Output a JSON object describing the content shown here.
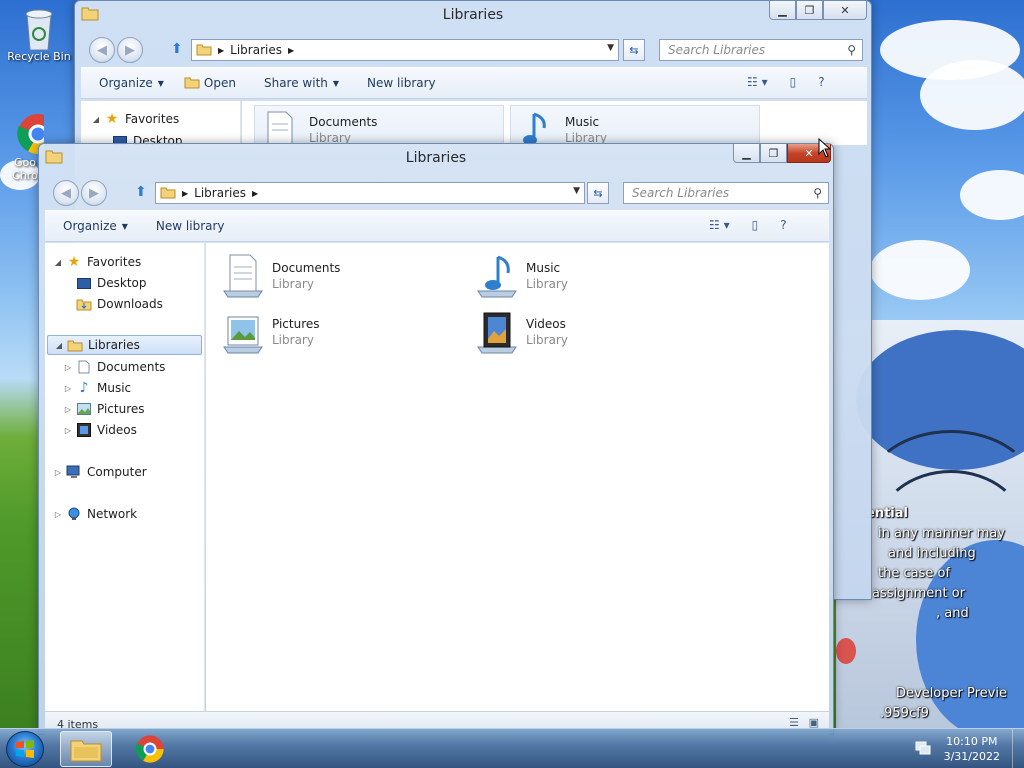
{
  "desktop": {
    "icons": [
      {
        "label": "Recycle Bin",
        "icon": "recycle-bin-icon"
      },
      {
        "label": "Goo Chro",
        "icon": "chrome-icon"
      }
    ],
    "watermark": {
      "line1": "ential",
      "line2": "in any manner may",
      "line3": "and including",
      "line4": "the case of",
      "line5": "assignment or",
      "line6": ", and",
      "line7": "Developer Previe",
      "line8": ".959cf9"
    }
  },
  "back_window": {
    "title": "Libraries",
    "address_crumb": "Libraries",
    "search_placeholder": "Search Libraries",
    "commands": {
      "organize": "Organize",
      "open": "Open",
      "share": "Share with",
      "new_library": "New library"
    },
    "nav": {
      "favorites": "Favorites",
      "desktop": "Desktop",
      "downloads": "Downloads"
    },
    "tiles": [
      {
        "name": "Documents",
        "sub": "Library"
      },
      {
        "name": "Music",
        "sub": "Library"
      }
    ]
  },
  "front_window": {
    "title": "Libraries",
    "address_crumb": "Libraries",
    "search_placeholder": "Search Libraries",
    "commands": {
      "organize": "Organize",
      "new_library": "New library"
    },
    "nav": {
      "favorites": "Favorites",
      "desktop": "Desktop",
      "downloads": "Downloads",
      "libraries": "Libraries",
      "documents": "Documents",
      "music": "Music",
      "pictures": "Pictures",
      "videos": "Videos",
      "computer": "Computer",
      "network": "Network"
    },
    "tiles": [
      {
        "name": "Documents",
        "sub": "Library",
        "icon": "documents-library-icon"
      },
      {
        "name": "Music",
        "sub": "Library",
        "icon": "music-library-icon"
      },
      {
        "name": "Pictures",
        "sub": "Library",
        "icon": "pictures-library-icon"
      },
      {
        "name": "Videos",
        "sub": "Library",
        "icon": "videos-library-icon"
      }
    ],
    "status": "4 items"
  },
  "taskbar": {
    "time": "10:10 PM",
    "date": "3/31/2022",
    "pinned": [
      "windows-explorer-icon",
      "chrome-icon"
    ]
  },
  "colors": {
    "accent": "#2a7bd1",
    "close": "#c6452a",
    "selection": "#cde0f7"
  }
}
